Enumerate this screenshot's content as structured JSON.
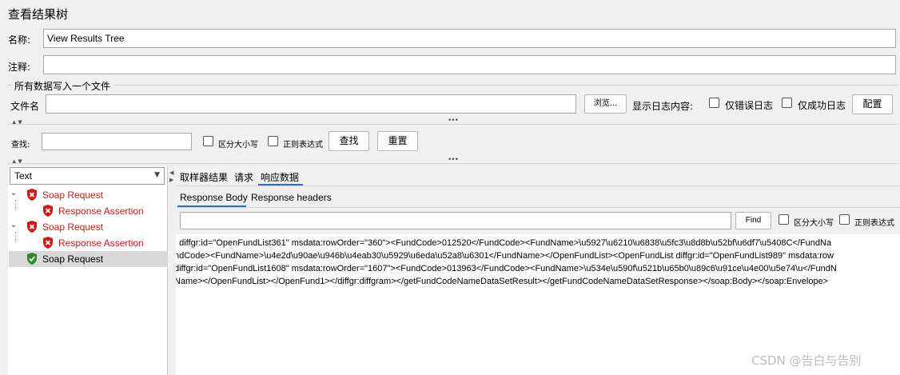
{
  "window": {
    "title": "查看结果树"
  },
  "form": {
    "name_label": "名称:",
    "name_value": "View Results Tree",
    "comment_label": "注释:",
    "comment_value": ""
  },
  "file_section": {
    "group_title": "所有数据写入一个文件",
    "filename_label": "文件名",
    "filename_value": "",
    "browse_button": "浏览...",
    "log_content_label": "显示日志内容:",
    "errors_only_label": "仅错误日志",
    "success_only_label": "仅成功日志",
    "configure_button": "配置"
  },
  "search_bar": {
    "label": "查找:",
    "value": "",
    "case_sensitive_label": "区分大小写",
    "regex_label": "正则表达式",
    "find_button": "查找",
    "reset_button": "重置"
  },
  "renderer": {
    "selected": "Text"
  },
  "tree": {
    "items": [
      {
        "label": "Soap Request",
        "status": "error",
        "level": 0,
        "expanded": true
      },
      {
        "label": "Response Assertion",
        "status": "error",
        "level": 1
      },
      {
        "label": "Soap Request",
        "status": "error",
        "level": 0,
        "expanded": true
      },
      {
        "label": "Response Assertion",
        "status": "error",
        "level": 1
      },
      {
        "label": "Soap Request",
        "status": "success",
        "level": 0,
        "selected": true
      }
    ]
  },
  "tabs": {
    "main": [
      "取样器结果",
      "请求",
      "响应数据"
    ],
    "main_active": "响应数据",
    "sub": [
      "Response Body",
      "Response headers"
    ],
    "sub_active": "Response Body"
  },
  "response_search": {
    "value": "",
    "find_button": "Find",
    "case_sensitive_label": "区分大小写",
    "regex_label": "正则表达式"
  },
  "response_body": {
    "lines": [
      ": diffgr:id=\"OpenFundList361\" msdata:rowOrder=\"360\"><FundCode>012520</FundCode><FundName>\\u5927\\u6210\\u6838\\u5fc3\\u8d8b\\u52bf\\u6df7\\u5408C</FundNa",
      "ndCode><FundName>\\u4e2d\\u90ae\\u946b\\u4eab30\\u5929\\u6eda\\u52a8\\u6301</FundName></OpenFundList><OpenFundList diffgr:id=\"OpenFundList989\" msdata:row",
      "diffgr:id=\"OpenFundList1608\" msdata:rowOrder=\"1607\"><FundCode>013963</FundCode><FundName>\\u534e\\u590f\\u521b\\u65b0\\u89c6\\u91ce\\u4e00\\u5e74\\u</FundN",
      "Name></OpenFundList></OpenFund1></diffgr:diffgram></getFundCodeNameDataSetResult></getFundCodeNameDataSetResponse></soap:Body></soap:Envelope>"
    ]
  },
  "watermark": "CSDN @告白与告别",
  "colors": {
    "error": "#d01818",
    "success": "#2a8a2a",
    "active_tab": "#1f6fd6"
  }
}
